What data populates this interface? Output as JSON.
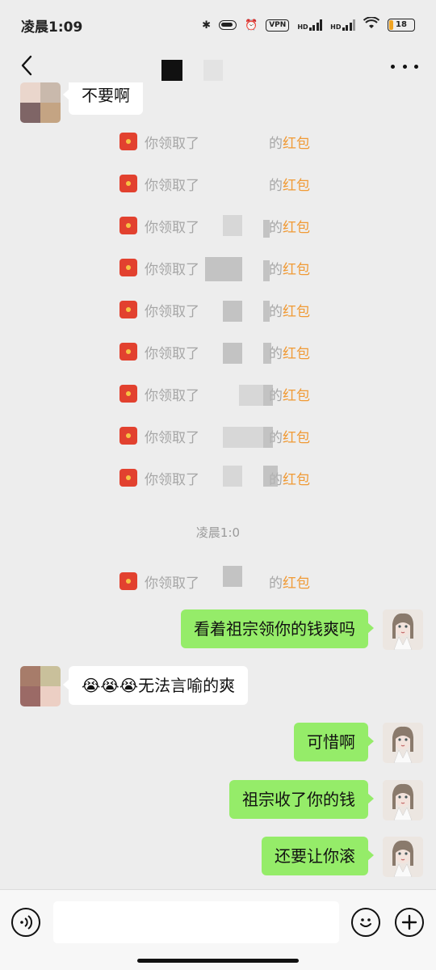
{
  "status_bar": {
    "time": "凌晨1:09",
    "vpn": "VPN",
    "hd": "HD",
    "battery": "18",
    "battery_percent": 18
  },
  "nav": {
    "back_icon": "chevron-left-icon",
    "more_icon": "more-dots-icon"
  },
  "messages": {
    "top_partial": "不要啊",
    "red_packet": {
      "prefix": "你领取了",
      "de": "的",
      "red_packet_word": "红包",
      "prefix_cut": "你领取了",
      "prefix_cut2": "你领取了"
    },
    "timestamp": "凌晨1:0",
    "m1": "看着祖宗领你的钱爽吗",
    "m2": "😭😭😭无法言喻的爽",
    "m3": "可惜啊",
    "m4": "祖宗收了你的钱",
    "m5": "还要让你滚"
  },
  "input": {
    "voice_icon": "voice-icon",
    "emoji_icon": "emoji-icon",
    "plus_icon": "plus-icon",
    "value": ""
  },
  "colors": {
    "background": "#ededed",
    "green_bubble": "#95ec69",
    "red_packet_text": "#f09a35",
    "red_packet_icon": "#e2412f"
  }
}
